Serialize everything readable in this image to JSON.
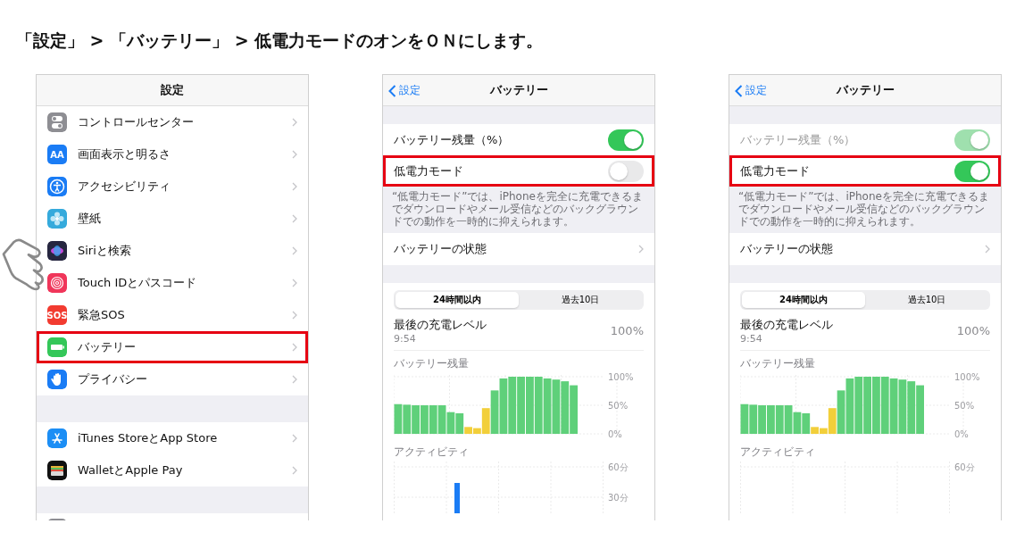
{
  "heading": "「設定」 > 「バッテリー」 > 低電力モードのオンをＯＮにします。",
  "screens": [
    {
      "kind": "settings",
      "nav": {
        "title": "設定"
      },
      "groups": [
        [
          {
            "label": "コントロールセンター",
            "highlighted": false
          },
          {
            "label": "画面表示と明るさ",
            "icon_text": "AA",
            "highlighted": false
          },
          {
            "label": "アクセシビリティ",
            "highlighted": false
          },
          {
            "label": "壁紙",
            "highlighted": false
          },
          {
            "label": "Siriと検索",
            "highlighted": false
          },
          {
            "label": "Touch IDとパスコード",
            "highlighted": false
          },
          {
            "label": "緊急SOS",
            "icon_text": "SOS",
            "highlighted": false
          },
          {
            "label": "バッテリー",
            "highlighted": true
          },
          {
            "label": "プライバシー",
            "highlighted": false
          }
        ],
        [
          {
            "label": "iTunes StoreとApp Store",
            "highlighted": false
          },
          {
            "label": "WalletとApple Pay",
            "highlighted": false
          }
        ]
      ]
    },
    {
      "kind": "battery",
      "nav": {
        "back": "設定",
        "title": "バッテリー"
      },
      "toggles": [
        {
          "label": "バッテリー残量（%）",
          "on": true,
          "disabled": false,
          "highlighted": false
        },
        {
          "label": "低電力モード",
          "on": false,
          "disabled": false,
          "highlighted": true
        }
      ],
      "note": "“低電力モード”では、iPhoneを完全に充電できるまでダウンロードやメール受信などのバックグラウンドでの動作を一時的に抑えられます。",
      "link_row": "バッテリーの状態",
      "segments": [
        {
          "label": "24時間以内",
          "selected": true
        },
        {
          "label": "過去10日",
          "selected": false
        }
      ],
      "last_charge": {
        "label": "最後の充電レベル",
        "time": "9:54",
        "value": "100%"
      },
      "battery_chart": {
        "chart_data": {
          "type": "bar",
          "title": "バッテリー残量",
          "ylim": [
            0,
            100
          ],
          "yticks": [
            {
              "value": 100,
              "label": "100%"
            },
            {
              "value": 50,
              "label": "50%"
            },
            {
              "value": 0,
              "label": "0%"
            }
          ],
          "series": [
            {
              "color": "#5fd07a",
              "values": [
                52,
                51,
                50,
                50,
                50,
                50,
                38,
                36,
                null,
                null,
                null,
                76,
                97,
                100,
                100,
                100,
                100,
                97,
                95,
                92,
                85,
                null,
                null,
                null
              ]
            },
            {
              "color": "#f2cf3a",
              "values": [
                null,
                null,
                null,
                null,
                null,
                null,
                null,
                null,
                12,
                10,
                45,
                null,
                null,
                null,
                null,
                null,
                null,
                null,
                null,
                null,
                null,
                null,
                null,
                null
              ]
            }
          ]
        }
      },
      "activity": {
        "title": "アクティビティ",
        "tick_labels": [
          "60分",
          "30分"
        ]
      }
    },
    {
      "kind": "battery",
      "nav": {
        "back": "設定",
        "title": "バッテリー"
      },
      "toggles": [
        {
          "label": "バッテリー残量（%）",
          "on": true,
          "disabled": true,
          "highlighted": false
        },
        {
          "label": "低電力モード",
          "on": true,
          "disabled": false,
          "highlighted": true
        }
      ],
      "note": "“低電力モード”では、iPhoneを完全に充電できるまでダウンロードやメール受信などのバックグラウンドでの動作を一時的に抑えられます。",
      "link_row": "バッテリーの状態",
      "segments": [
        {
          "label": "24時間以内",
          "selected": true
        },
        {
          "label": "過去10日",
          "selected": false
        }
      ],
      "last_charge": {
        "label": "最後の充電レベル",
        "time": "9:54",
        "value": "100%"
      },
      "battery_chart": {
        "chart_data": {
          "type": "bar",
          "title": "バッテリー残量",
          "ylim": [
            0,
            100
          ],
          "yticks": [
            {
              "value": 100,
              "label": "100%"
            },
            {
              "value": 50,
              "label": "50%"
            },
            {
              "value": 0,
              "label": "0%"
            }
          ],
          "series": [
            {
              "color": "#5fd07a",
              "values": [
                52,
                51,
                50,
                50,
                50,
                50,
                38,
                36,
                null,
                null,
                null,
                76,
                97,
                100,
                100,
                100,
                100,
                97,
                95,
                92,
                85,
                null,
                null,
                null
              ]
            },
            {
              "color": "#f2cf3a",
              "values": [
                null,
                null,
                null,
                null,
                null,
                null,
                null,
                null,
                12,
                10,
                45,
                null,
                null,
                null,
                null,
                null,
                null,
                null,
                null,
                null,
                null,
                null,
                null,
                null
              ]
            }
          ]
        }
      },
      "activity": {
        "title": "アクティビティ",
        "tick_labels": [
          "60分"
        ]
      }
    }
  ]
}
